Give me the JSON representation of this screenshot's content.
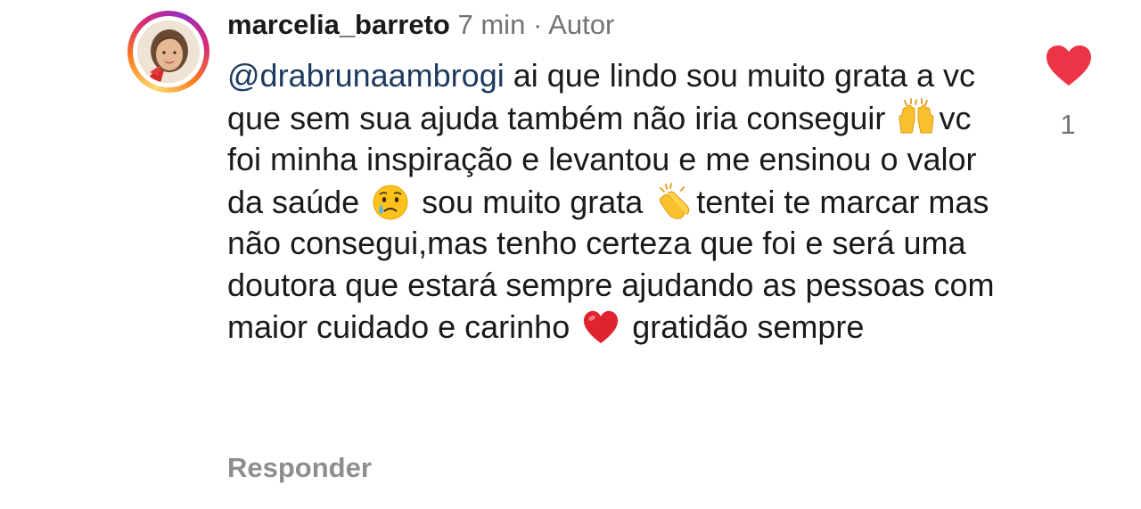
{
  "comment": {
    "username": "marcelia_barreto",
    "time": "7 min",
    "separator": "·",
    "author_badge": "Autor",
    "mention": "@drabrunaambrogi",
    "text_part_1": " ai que lindo sou muito grata a vc que sem sua ajuda também não iria conseguir ",
    "text_part_2": "vc foi minha inspiração e levantou e me ensinou o valor da saúde ",
    "text_part_3": " sou muito grata ",
    "text_part_4": "tentei te marcar mas não consegui,mas tenho certeza que foi e será uma doutora que estará sempre ajudando as pessoas com maior cuidado e carinho ",
    "text_part_5": " gratidão sempre",
    "emojis": [
      "raising-hands-emoji",
      "crying-face-emoji",
      "clapping-hands-emoji",
      "red-heart-emoji"
    ],
    "reply_label": "Responder",
    "like_count": "1",
    "like_icon": "heart-icon",
    "like_color": "#ed3346",
    "mention_color": "#1e3a5f"
  }
}
